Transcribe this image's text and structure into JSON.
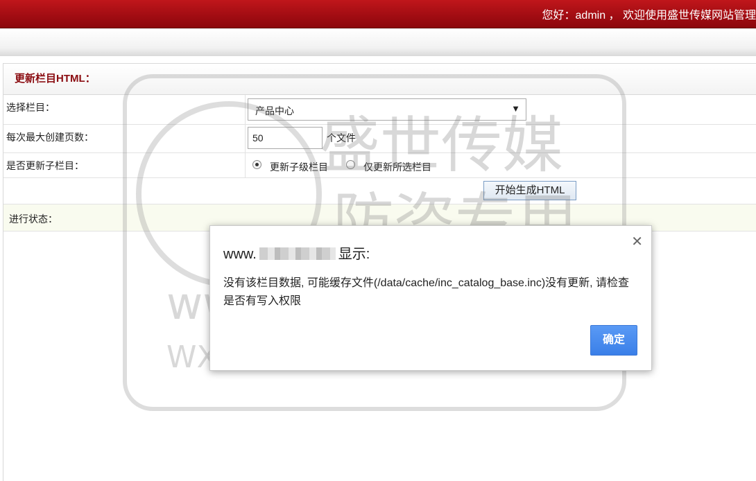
{
  "header": {
    "welcome_text": "您好：admin ， 欢迎使用盛世传媒网站管理"
  },
  "panel": {
    "title": "更新栏目HTML：",
    "select_category_label": "选择栏目：",
    "select_category_value": "产品中心",
    "max_pages_label": "每次最大创建页数：",
    "max_pages_value": "50",
    "max_pages_unit": "个文件",
    "update_children_label": "是否更新子栏目：",
    "radio_children_label": "更新子级栏目",
    "radio_selected_only_label": "仅更新所选栏目",
    "generate_button": "开始生成HTML",
    "status_label": "进行状态："
  },
  "watermark": {
    "line1": "盛世传媒",
    "line2": "防盗专用",
    "line3": "www.sscmwl.com",
    "line4": "WX/手机：13968746378"
  },
  "dialog": {
    "title_prefix": "www.",
    "title_suffix": "显示:",
    "message": "没有该栏目数据, 可能缓存文件(/data/cache/inc_catalog_base.inc)没有更新, 请检查是否有写入权限",
    "ok_button": "确定",
    "close_icon": "close-icon"
  }
}
